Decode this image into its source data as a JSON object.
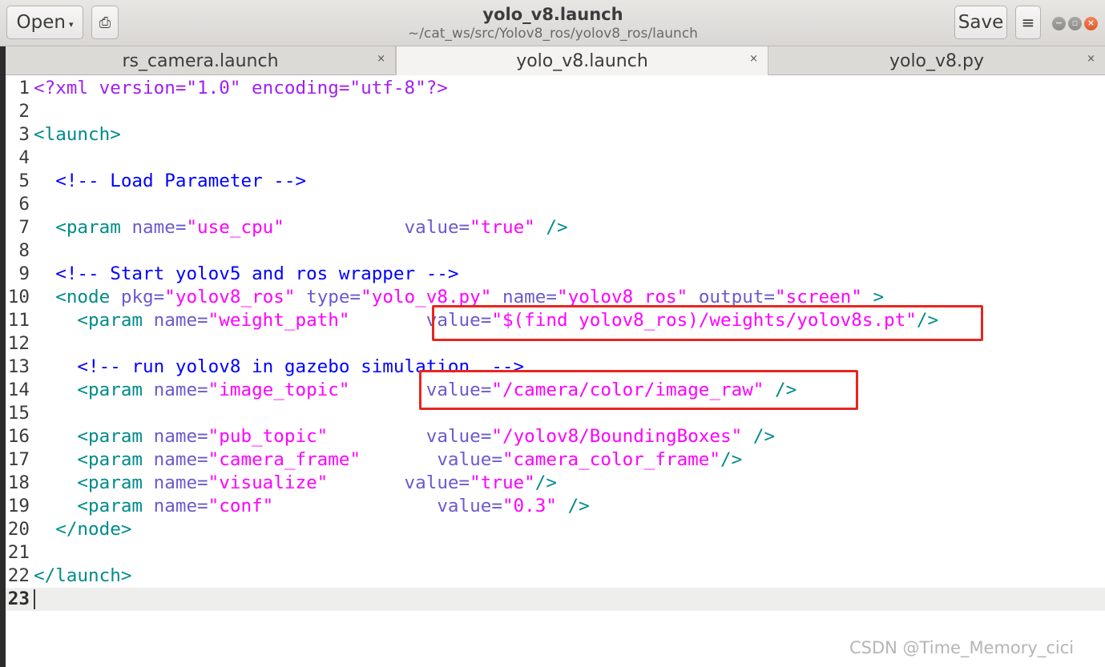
{
  "header": {
    "open_label": "Open",
    "open_caret": "▾",
    "pin_icon": "⎙",
    "title": "yolo_v8.launch",
    "subtitle": "~/cat_ws/src/Yolov8_ros/yolov8_ros/launch",
    "save_label": "Save",
    "menu_icon": "≡",
    "min_icon": "−",
    "max_icon": "▫",
    "close_icon": "×"
  },
  "tabs": [
    {
      "label": "rs_camera.launch",
      "close": "×",
      "active": false
    },
    {
      "label": "yolo_v8.launch",
      "close": "×",
      "active": true
    },
    {
      "label": "yolo_v8.py",
      "close": "×",
      "active": false
    }
  ],
  "editor": {
    "lines": [
      {
        "n": "1",
        "parts": [
          [
            "pi",
            "<?xml version=\"1.0\" encoding=\"utf-8\"?>"
          ]
        ]
      },
      {
        "n": "2",
        "parts": []
      },
      {
        "n": "3",
        "parts": [
          [
            "tag",
            "<launch>"
          ]
        ]
      },
      {
        "n": "4",
        "parts": []
      },
      {
        "n": "5",
        "parts": [
          [
            "plain",
            "  "
          ],
          [
            "cmt",
            "<!-- Load Parameter -->"
          ]
        ]
      },
      {
        "n": "6",
        "parts": []
      },
      {
        "n": "7",
        "parts": [
          [
            "plain",
            "  "
          ],
          [
            "tag",
            "<param "
          ],
          [
            "attr",
            "name="
          ],
          [
            "str",
            "\"use_cpu\""
          ],
          [
            "plain",
            "           "
          ],
          [
            "attr",
            "value="
          ],
          [
            "str",
            "\"true\""
          ],
          [
            "tag",
            " />"
          ]
        ]
      },
      {
        "n": "8",
        "parts": []
      },
      {
        "n": "9",
        "parts": [
          [
            "plain",
            "  "
          ],
          [
            "cmt",
            "<!-- Start yolov5 and ros wrapper -->"
          ]
        ]
      },
      {
        "n": "10",
        "parts": [
          [
            "plain",
            "  "
          ],
          [
            "tag",
            "<node "
          ],
          [
            "attr",
            "pkg="
          ],
          [
            "str",
            "\"yolov8_ros\""
          ],
          [
            "attr",
            " type="
          ],
          [
            "str",
            "\"yolo_v8.py\""
          ],
          [
            "attr",
            " name="
          ],
          [
            "str",
            "\"yolov8_ros\""
          ],
          [
            "attr",
            " output="
          ],
          [
            "str",
            "\"screen\""
          ],
          [
            "tag",
            " >"
          ]
        ]
      },
      {
        "n": "11",
        "parts": [
          [
            "plain",
            "    "
          ],
          [
            "tag",
            "<param "
          ],
          [
            "attr",
            "name="
          ],
          [
            "str",
            "\"weight_path\""
          ],
          [
            "plain",
            "       "
          ],
          [
            "attr",
            "value="
          ],
          [
            "str",
            "\"$(find yolov8_ros)/weights/yolov8s.pt\""
          ],
          [
            "tag",
            "/>"
          ]
        ]
      },
      {
        "n": "12",
        "parts": []
      },
      {
        "n": "13",
        "parts": [
          [
            "plain",
            "    "
          ],
          [
            "cmt",
            "<!-- run yolov8 in gazebo simulation  -->"
          ]
        ]
      },
      {
        "n": "14",
        "parts": [
          [
            "plain",
            "    "
          ],
          [
            "tag",
            "<param "
          ],
          [
            "attr",
            "name="
          ],
          [
            "str",
            "\"image_topic\""
          ],
          [
            "plain",
            "       "
          ],
          [
            "attr",
            "value="
          ],
          [
            "str",
            "\"/camera/color/image_raw\""
          ],
          [
            "tag",
            " />"
          ]
        ]
      },
      {
        "n": "15",
        "parts": []
      },
      {
        "n": "16",
        "parts": [
          [
            "plain",
            "    "
          ],
          [
            "tag",
            "<param "
          ],
          [
            "attr",
            "name="
          ],
          [
            "str",
            "\"pub_topic\""
          ],
          [
            "plain",
            "         "
          ],
          [
            "attr",
            "value="
          ],
          [
            "str",
            "\"/yolov8/BoundingBoxes\""
          ],
          [
            "tag",
            " />"
          ]
        ]
      },
      {
        "n": "17",
        "parts": [
          [
            "plain",
            "    "
          ],
          [
            "tag",
            "<param "
          ],
          [
            "attr",
            "name="
          ],
          [
            "str",
            "\"camera_frame\""
          ],
          [
            "plain",
            "       "
          ],
          [
            "attr",
            "value="
          ],
          [
            "str",
            "\"camera_color_frame\""
          ],
          [
            "tag",
            "/>"
          ]
        ]
      },
      {
        "n": "18",
        "parts": [
          [
            "plain",
            "    "
          ],
          [
            "tag",
            "<param "
          ],
          [
            "attr",
            "name="
          ],
          [
            "str",
            "\"visualize\""
          ],
          [
            "plain",
            "       "
          ],
          [
            "attr",
            "value="
          ],
          [
            "str",
            "\"true\""
          ],
          [
            "tag",
            "/>"
          ]
        ]
      },
      {
        "n": "19",
        "parts": [
          [
            "plain",
            "    "
          ],
          [
            "tag",
            "<param "
          ],
          [
            "attr",
            "name="
          ],
          [
            "str",
            "\"conf\""
          ],
          [
            "plain",
            "               "
          ],
          [
            "attr",
            "value="
          ],
          [
            "str",
            "\"0.3\""
          ],
          [
            "tag",
            " />"
          ]
        ]
      },
      {
        "n": "20",
        "parts": [
          [
            "plain",
            "  "
          ],
          [
            "tag",
            "</node>"
          ]
        ]
      },
      {
        "n": "21",
        "parts": []
      },
      {
        "n": "22",
        "parts": [
          [
            "tag",
            "</launch>"
          ]
        ]
      },
      {
        "n": "23",
        "parts": [],
        "current": true
      }
    ]
  },
  "watermark": "CSDN @Time_Memory_cici",
  "colors": {
    "tag": "#008b8b",
    "attribute": "#6a5acd",
    "string": "#ff00ff",
    "comment": "#0000ff",
    "processing_instruction": "#a020f0",
    "highlight_box": "#e8261f",
    "close_button": "#e0582a"
  }
}
